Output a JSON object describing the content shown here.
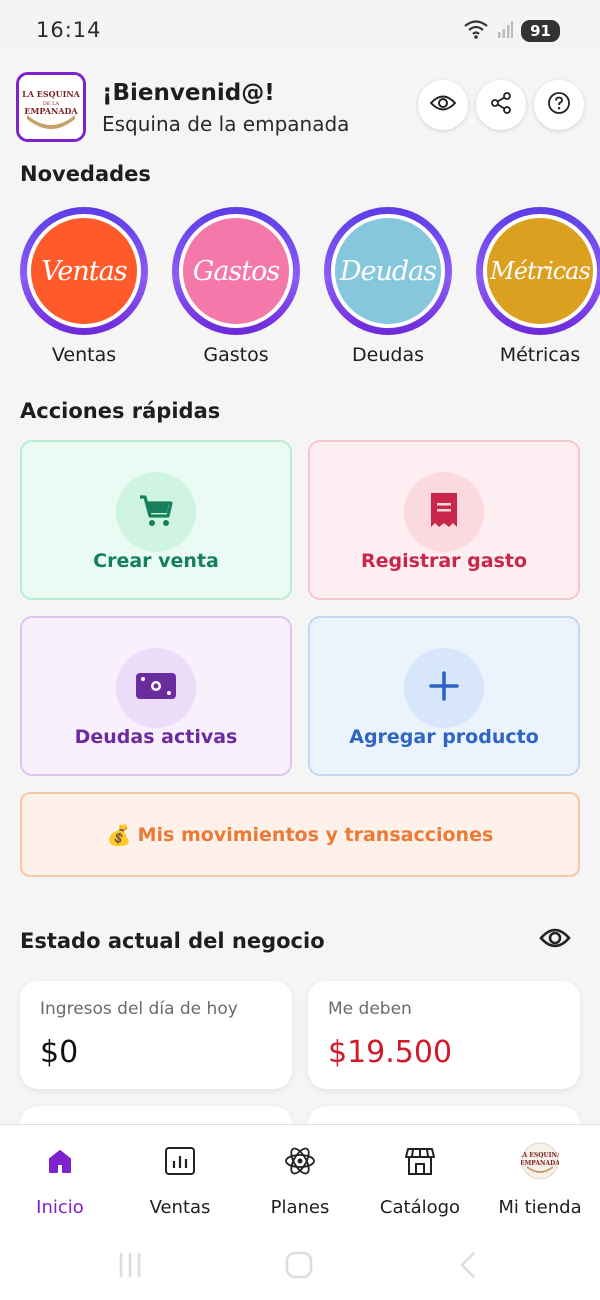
{
  "status_bar": {
    "time": "16:14",
    "battery": "91"
  },
  "header": {
    "welcome": "¡Bienvenid@!",
    "shop_name": "Esquina de la empanada",
    "logo_text": "LA ESQUINA DE LA EMPANADA"
  },
  "novedades": {
    "title": "Novedades",
    "items": [
      {
        "image_text": "Ventas",
        "label": "Ventas",
        "color": "#ff5a2a"
      },
      {
        "image_text": "Gastos",
        "label": "Gastos",
        "color": "#f478a9"
      },
      {
        "image_text": "Deudas",
        "label": "Deudas",
        "color": "#86c7dd"
      },
      {
        "image_text": "Métricas",
        "label": "Métricas",
        "color": "#dca021"
      }
    ]
  },
  "quick_actions": {
    "title": "Acciones rápidas",
    "create_sale": "Crear venta",
    "register_expense": "Registrar gasto",
    "active_debts": "Deudas activas",
    "add_product": "Agregar producto"
  },
  "movements": {
    "emoji": "💰",
    "label": "Mis movimientos y transacciones"
  },
  "business_status": {
    "title": "Estado actual del negocio",
    "income_today_label": "Ingresos del día de hoy",
    "income_today_value": "$0",
    "owed_label": "Me deben",
    "owed_value": "$19.500"
  },
  "nav": {
    "home": "Inicio",
    "sales": "Ventas",
    "plans": "Planes",
    "catalog": "Catálogo",
    "my_store": "Mi tienda"
  },
  "colors": {
    "accent": "#7e22ce",
    "green": "#16805a",
    "red": "#c8274b",
    "purple": "#6b2c9e",
    "blue": "#2f64c0",
    "orange": "#ea7a36",
    "debt_red": "#d11a2a"
  }
}
